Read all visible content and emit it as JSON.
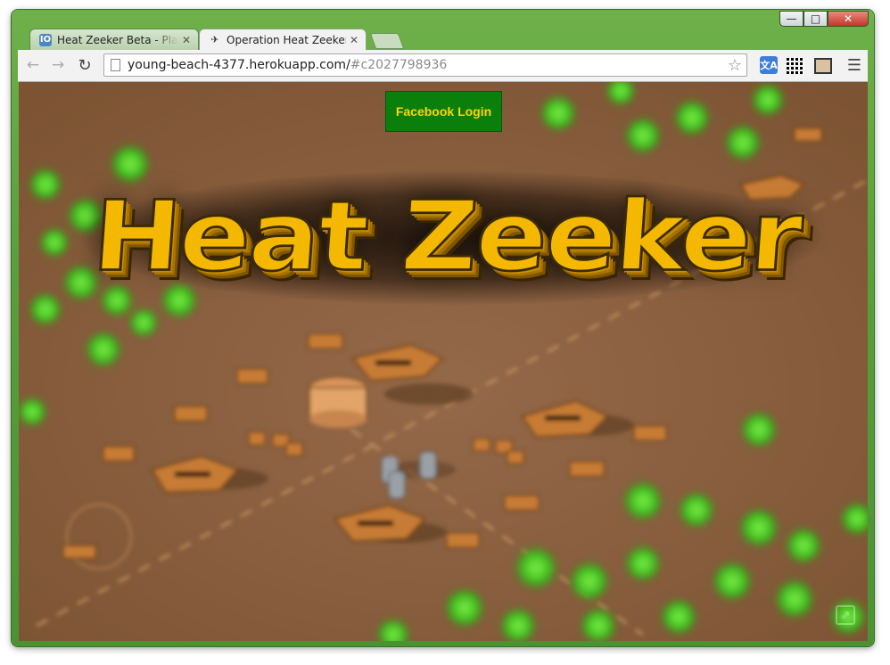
{
  "browser": {
    "tabs": [
      {
        "title": "Heat Zeeker Beta - Player.",
        "icon": "player-io-icon",
        "active": false
      },
      {
        "title": "Operation Heat Zeeker",
        "icon": "heat-zeeker-favicon",
        "active": true
      }
    ],
    "url": {
      "host": "young-beach-4377.herokuapp.com/",
      "fragment": "#c2027798936"
    },
    "window_controls": {
      "minimize": "—",
      "maximize": "□",
      "close": "✕"
    }
  },
  "game": {
    "facebook_login_label": "Facebook Login",
    "logo_text": "Heat Zeeker",
    "colors": {
      "logo_yellow": "#f5b800",
      "ground": "#8e6541",
      "login_bg": "#0b7f0b",
      "login_text": "#ffd400"
    }
  }
}
